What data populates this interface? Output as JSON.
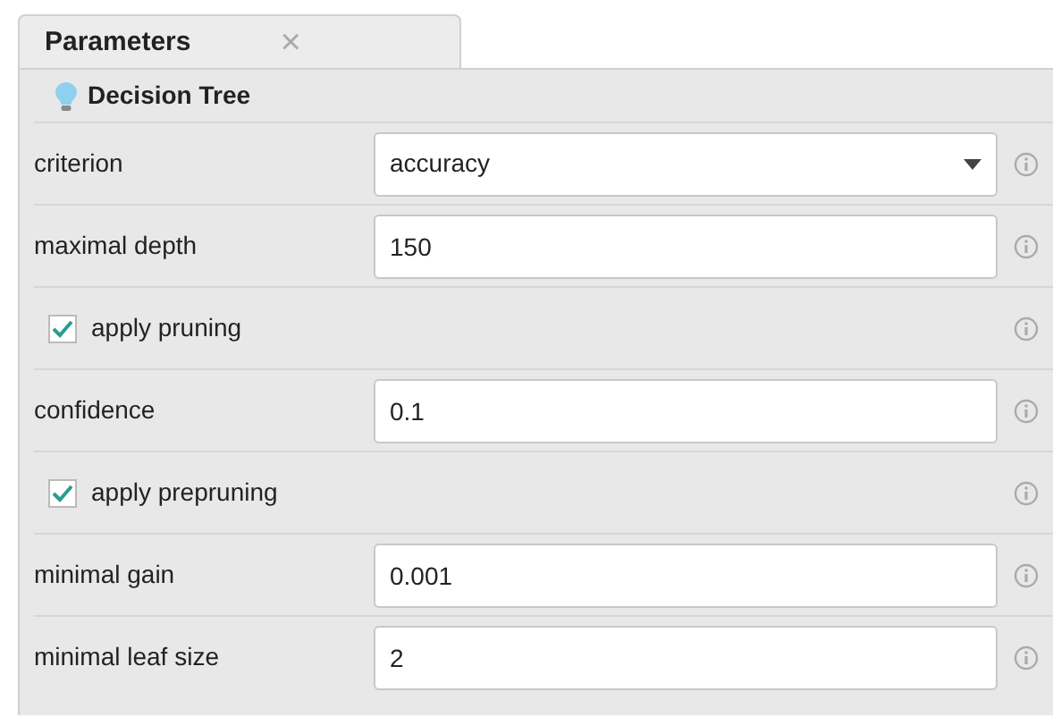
{
  "tab": {
    "title": "Parameters",
    "close": "×"
  },
  "operator": {
    "title": "Decision Tree"
  },
  "parameters": [
    {
      "kind": "select",
      "label": "criterion",
      "value": "accuracy"
    },
    {
      "kind": "text",
      "label": "maximal depth",
      "value": "150"
    },
    {
      "kind": "checkbox",
      "label": "apply pruning",
      "checked": true
    },
    {
      "kind": "text",
      "label": "confidence",
      "value": "0.1"
    },
    {
      "kind": "checkbox",
      "label": "apply prepruning",
      "checked": true
    },
    {
      "kind": "text",
      "label": "minimal gain",
      "value": "0.001"
    },
    {
      "kind": "text",
      "label": "minimal leaf size",
      "value": "2"
    }
  ]
}
